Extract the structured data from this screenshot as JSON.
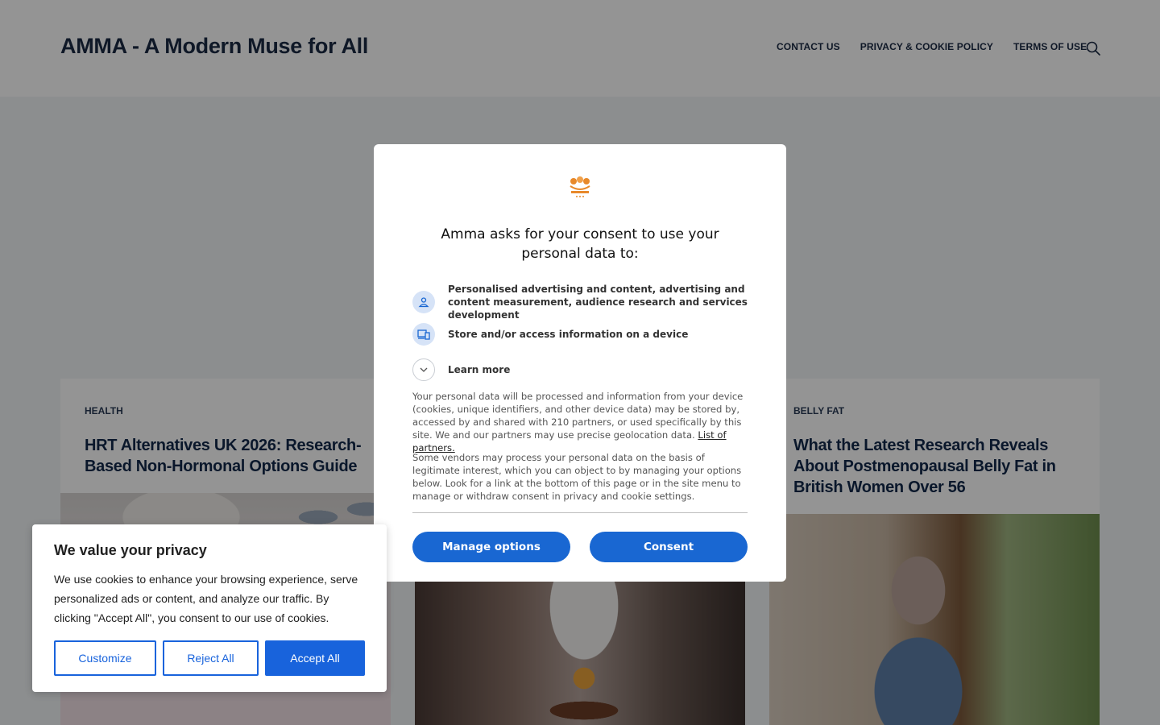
{
  "site": {
    "title": "AMMA - A Modern Muse for All",
    "nav": [
      "CONTACT US",
      "PRIVACY & COOKIE POLICY",
      "TERMS OF USE"
    ],
    "search_icon": "search-icon"
  },
  "cards": [
    {
      "category": "HEALTH",
      "headline": "HRT Alternatives UK 2026: Research-Based Non-Hormonal Options Guide"
    },
    {
      "category": "",
      "headline": ""
    },
    {
      "category": "BELLY FAT",
      "headline": "What the Latest Research Reveals About Postmenopausal Belly Fat in British Women Over 56"
    }
  ],
  "consent_modal": {
    "logo_text": "AMMA",
    "title": "Amma asks for your consent to use your personal data to:",
    "purposes": [
      {
        "icon": "person-icon",
        "text": "Personalised advertising and content, advertising and content measurement, audience research and services development"
      },
      {
        "icon": "device-icon",
        "text": "Store and/or access information on a device"
      }
    ],
    "learn_more": "Learn more",
    "body_1": "Your personal data will be processed and information from your device (cookies, unique identifiers, and other device data) may be stored by, accessed by and shared with 210 partners, or used specifically by this site. We and our partners may use precise geolocation data.",
    "partners_link": "List of partners.",
    "body_2": "Some vendors may process your personal data on the basis of legitimate interest, which you can object to by managing your options below. Look for a link at the bottom of this page or in the site menu to manage or withdraw consent in privacy and cookie settings.",
    "manage_button": "Manage options",
    "consent_button": "Consent",
    "accent_color": "#1967d2"
  },
  "cookie_banner": {
    "title": "We value your privacy",
    "text": "We use cookies to enhance your browsing experience, serve personalized ads or content, and analyze our traffic. By clicking \"Accept All\", you consent to our use of cookies.",
    "customize": "Customize",
    "reject": "Reject All",
    "accept": "Accept All",
    "accent_color": "#1863dc"
  }
}
